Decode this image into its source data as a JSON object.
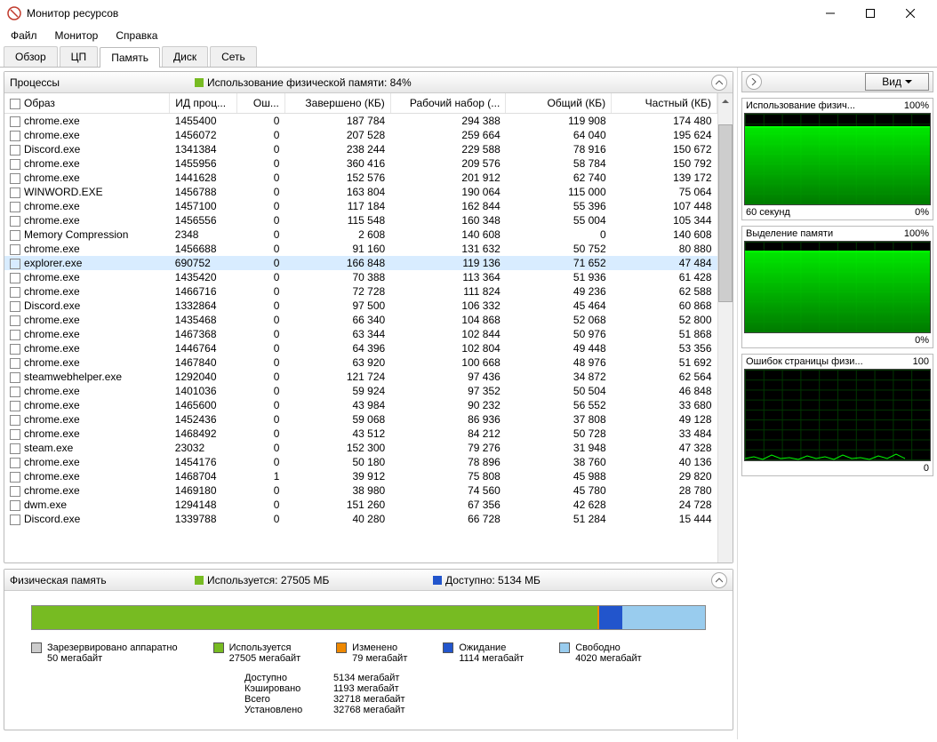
{
  "window": {
    "title": "Монитор ресурсов"
  },
  "menu": {
    "file": "Файл",
    "monitor": "Монитор",
    "help": "Справка"
  },
  "tabs": {
    "overview": "Обзор",
    "cpu": "ЦП",
    "memory": "Память",
    "disk": "Диск",
    "network": "Сеть"
  },
  "processes_panel": {
    "title": "Процессы",
    "usage_label": "Использование физической памяти: 84%",
    "columns": {
      "image": "Образ",
      "pid": "ИД проц...",
      "errors": "Ош...",
      "commit": "Завершено (КБ)",
      "working_set": "Рабочий набор (...",
      "shareable": "Общий (КБ)",
      "private": "Частный (КБ)"
    },
    "rows": [
      {
        "image": "chrome.exe",
        "pid": "1455400",
        "err": "0",
        "commit": "187 784",
        "ws": "294 388",
        "share": "119 908",
        "priv": "174 480"
      },
      {
        "image": "chrome.exe",
        "pid": "1456072",
        "err": "0",
        "commit": "207 528",
        "ws": "259 664",
        "share": "64 040",
        "priv": "195 624"
      },
      {
        "image": "Discord.exe",
        "pid": "1341384",
        "err": "0",
        "commit": "238 244",
        "ws": "229 588",
        "share": "78 916",
        "priv": "150 672"
      },
      {
        "image": "chrome.exe",
        "pid": "1455956",
        "err": "0",
        "commit": "360 416",
        "ws": "209 576",
        "share": "58 784",
        "priv": "150 792"
      },
      {
        "image": "chrome.exe",
        "pid": "1441628",
        "err": "0",
        "commit": "152 576",
        "ws": "201 912",
        "share": "62 740",
        "priv": "139 172"
      },
      {
        "image": "WINWORD.EXE",
        "pid": "1456788",
        "err": "0",
        "commit": "163 804",
        "ws": "190 064",
        "share": "115 000",
        "priv": "75 064"
      },
      {
        "image": "chrome.exe",
        "pid": "1457100",
        "err": "0",
        "commit": "117 184",
        "ws": "162 844",
        "share": "55 396",
        "priv": "107 448"
      },
      {
        "image": "chrome.exe",
        "pid": "1456556",
        "err": "0",
        "commit": "115 548",
        "ws": "160 348",
        "share": "55 004",
        "priv": "105 344"
      },
      {
        "image": "Memory Compression",
        "pid": "2348",
        "err": "0",
        "commit": "2 608",
        "ws": "140 608",
        "share": "0",
        "priv": "140 608"
      },
      {
        "image": "chrome.exe",
        "pid": "1456688",
        "err": "0",
        "commit": "91 160",
        "ws": "131 632",
        "share": "50 752",
        "priv": "80 880"
      },
      {
        "image": "explorer.exe",
        "pid": "690752",
        "err": "0",
        "commit": "166 848",
        "ws": "119 136",
        "share": "71 652",
        "priv": "47 484",
        "selected": true
      },
      {
        "image": "chrome.exe",
        "pid": "1435420",
        "err": "0",
        "commit": "70 388",
        "ws": "113 364",
        "share": "51 936",
        "priv": "61 428"
      },
      {
        "image": "chrome.exe",
        "pid": "1466716",
        "err": "0",
        "commit": "72 728",
        "ws": "111 824",
        "share": "49 236",
        "priv": "62 588"
      },
      {
        "image": "Discord.exe",
        "pid": "1332864",
        "err": "0",
        "commit": "97 500",
        "ws": "106 332",
        "share": "45 464",
        "priv": "60 868"
      },
      {
        "image": "chrome.exe",
        "pid": "1435468",
        "err": "0",
        "commit": "66 340",
        "ws": "104 868",
        "share": "52 068",
        "priv": "52 800"
      },
      {
        "image": "chrome.exe",
        "pid": "1467368",
        "err": "0",
        "commit": "63 344",
        "ws": "102 844",
        "share": "50 976",
        "priv": "51 868"
      },
      {
        "image": "chrome.exe",
        "pid": "1446764",
        "err": "0",
        "commit": "64 396",
        "ws": "102 804",
        "share": "49 448",
        "priv": "53 356"
      },
      {
        "image": "chrome.exe",
        "pid": "1467840",
        "err": "0",
        "commit": "63 920",
        "ws": "100 668",
        "share": "48 976",
        "priv": "51 692"
      },
      {
        "image": "steamwebhelper.exe",
        "pid": "1292040",
        "err": "0",
        "commit": "121 724",
        "ws": "97 436",
        "share": "34 872",
        "priv": "62 564"
      },
      {
        "image": "chrome.exe",
        "pid": "1401036",
        "err": "0",
        "commit": "59 924",
        "ws": "97 352",
        "share": "50 504",
        "priv": "46 848"
      },
      {
        "image": "chrome.exe",
        "pid": "1465600",
        "err": "0",
        "commit": "43 984",
        "ws": "90 232",
        "share": "56 552",
        "priv": "33 680"
      },
      {
        "image": "chrome.exe",
        "pid": "1452436",
        "err": "0",
        "commit": "59 068",
        "ws": "86 936",
        "share": "37 808",
        "priv": "49 128"
      },
      {
        "image": "chrome.exe",
        "pid": "1468492",
        "err": "0",
        "commit": "43 512",
        "ws": "84 212",
        "share": "50 728",
        "priv": "33 484"
      },
      {
        "image": "steam.exe",
        "pid": "23032",
        "err": "0",
        "commit": "152 300",
        "ws": "79 276",
        "share": "31 948",
        "priv": "47 328"
      },
      {
        "image": "chrome.exe",
        "pid": "1454176",
        "err": "0",
        "commit": "50 180",
        "ws": "78 896",
        "share": "38 760",
        "priv": "40 136"
      },
      {
        "image": "chrome.exe",
        "pid": "1468704",
        "err": "1",
        "commit": "39 912",
        "ws": "75 808",
        "share": "45 988",
        "priv": "29 820"
      },
      {
        "image": "chrome.exe",
        "pid": "1469180",
        "err": "0",
        "commit": "38 980",
        "ws": "74 560",
        "share": "45 780",
        "priv": "28 780"
      },
      {
        "image": "dwm.exe",
        "pid": "1294148",
        "err": "0",
        "commit": "151 260",
        "ws": "67 356",
        "share": "42 628",
        "priv": "24 728"
      },
      {
        "image": "Discord.exe",
        "pid": "1339788",
        "err": "0",
        "commit": "40 280",
        "ws": "66 728",
        "share": "51 284",
        "priv": "15 444"
      }
    ]
  },
  "physical_memory": {
    "title": "Физическая память",
    "used_label": "Используется: 27505 МБ",
    "avail_label": "Доступно: 5134 МБ",
    "legend": {
      "reserved": {
        "label": "Зарезервировано аппаратно",
        "value": "50 мегабайт"
      },
      "used": {
        "label": "Используется",
        "value": "27505 мегабайт"
      },
      "modified": {
        "label": "Изменено",
        "value": "79 мегабайт"
      },
      "standby": {
        "label": "Ожидание",
        "value": "1114 мегабайт"
      },
      "free": {
        "label": "Свободно",
        "value": "4020 мегабайт"
      }
    },
    "stats": {
      "available": {
        "label": "Доступно",
        "value": "5134 мегабайт"
      },
      "cached": {
        "label": "Кэшировано",
        "value": "1193 мегабайт"
      },
      "total": {
        "label": "Всего",
        "value": "32718 мегабайт"
      },
      "installed": {
        "label": "Установлено",
        "value": "32768 мегабайт"
      }
    }
  },
  "side": {
    "view_btn": "Вид",
    "graph1": {
      "title": "Использование физич...",
      "top": "100%",
      "bottom_left": "60 секунд",
      "bottom_right": "0%"
    },
    "graph2": {
      "title": "Выделение памяти",
      "top": "100%",
      "bottom_right": "0%"
    },
    "graph3": {
      "title": "Ошибок страницы физи...",
      "top": "100",
      "bottom_right": "0"
    }
  },
  "colors": {
    "used": "#77bb22",
    "modified": "#ee8800",
    "standby": "#2255cc",
    "free": "#99ccee",
    "reserved": "#aaaaaa"
  }
}
